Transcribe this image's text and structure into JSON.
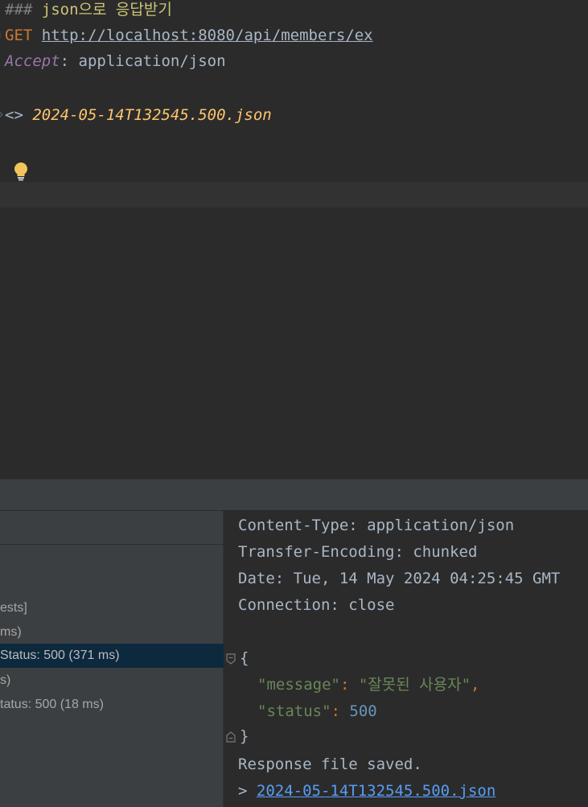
{
  "editor": {
    "comment_hashes": "###",
    "comment_text": " json으로 응답받기",
    "method": "GET",
    "url": "http://localhost:8080/api/members/ex",
    "header_name": "Accept",
    "header_sep": ": ",
    "header_value": "application/json",
    "response_marker": "<> ",
    "response_file": "2024-05-14T132545.500.json"
  },
  "runs": {
    "items": [
      {
        "label": "ests]"
      },
      {
        "label": "ms)"
      },
      {
        "label": "Status: 500 (371 ms)",
        "selected": true
      },
      {
        "label": "s)"
      },
      {
        "label": "tatus: 500 (18 ms)"
      }
    ]
  },
  "response": {
    "headers": [
      "Content-Type: application/json",
      "Transfer-Encoding: chunked",
      "Date: Tue, 14 May 2024 04:25:45 GMT",
      "Connection: close"
    ],
    "open_brace": "{",
    "message_key": "\"message\"",
    "message_value": "\"잘못된 사용자\"",
    "status_key": "\"status\"",
    "status_value": "500",
    "close_brace": "}",
    "saved_text": "Response file saved.",
    "saved_prefix": "> ",
    "saved_link": "2024-05-14T132545.500.json"
  },
  "colors": {
    "background": "#2b2b2b",
    "panel": "#3c3f41",
    "selection": "#0d293e",
    "keyword": "#cc7832",
    "string": "#6a8759",
    "number": "#6897bb",
    "link": "#589df6"
  }
}
